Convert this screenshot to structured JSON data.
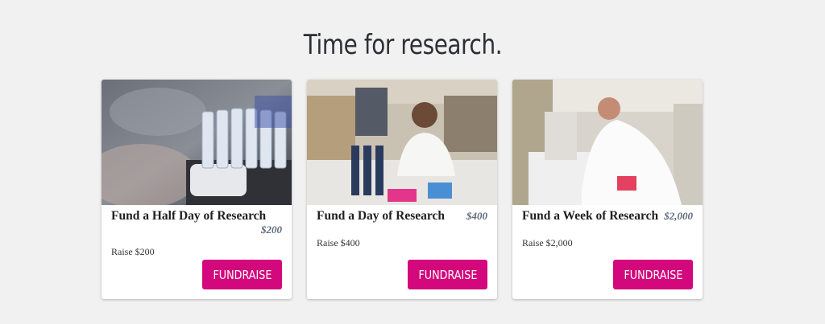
{
  "page": {
    "title": "Time for research."
  },
  "cards": [
    {
      "name": "Fund a Half Day of Research",
      "price": "$200",
      "raise": "Raise $200",
      "button": "FUNDRAISE",
      "image": "lab-test-tubes-photo"
    },
    {
      "name": "Fund a Day of Research",
      "price": "$400",
      "raise": "Raise $400",
      "button": "FUNDRAISE",
      "image": "researcher-writing-photo"
    },
    {
      "name": "Fund a Week of Research",
      "price": "$2,000",
      "raise": "Raise $2,000",
      "button": "FUNDRAISE",
      "image": "researcher-microscope-photo"
    }
  ],
  "colors": {
    "accent": "#d3087c",
    "background": "#f1f1f1",
    "price": "#5f6b7e"
  }
}
